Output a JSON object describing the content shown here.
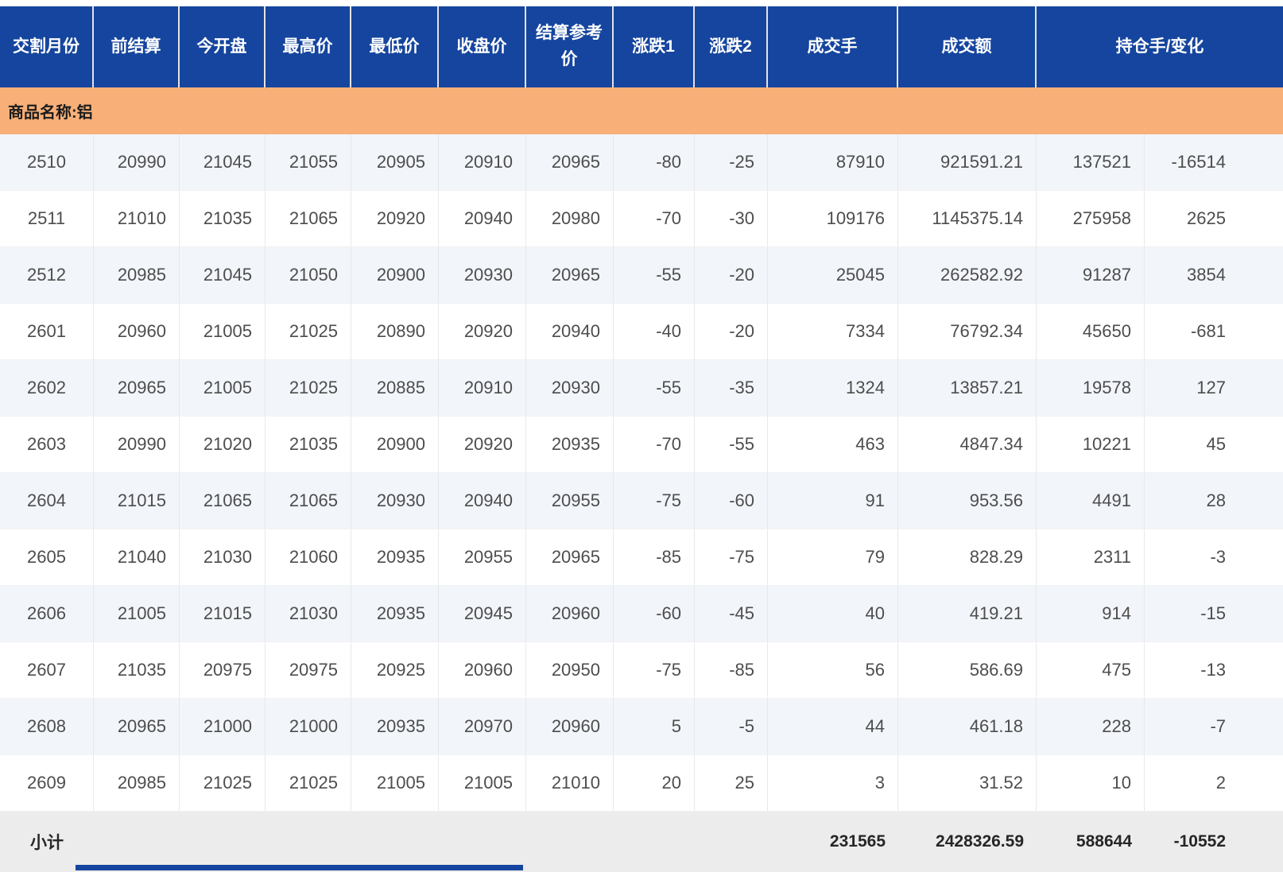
{
  "page": {
    "product_banner": "商品名称:铝"
  },
  "table": {
    "headers": [
      "交割月份",
      "前结算",
      "今开盘",
      "最高价",
      "最低价",
      "收盘价",
      "结算参考价",
      "涨跌1",
      "涨跌2",
      "成交手",
      "成交额",
      "持仓手/变化"
    ],
    "rows": [
      [
        "2510",
        "20990",
        "21045",
        "21055",
        "20905",
        "20910",
        "20965",
        "-80",
        "-25",
        "87910",
        "921591.21",
        "137521",
        "-16514"
      ],
      [
        "2511",
        "21010",
        "21035",
        "21065",
        "20920",
        "20940",
        "20980",
        "-70",
        "-30",
        "109176",
        "1145375.14",
        "275958",
        "2625"
      ],
      [
        "2512",
        "20985",
        "21045",
        "21050",
        "20900",
        "20930",
        "20965",
        "-55",
        "-20",
        "25045",
        "262582.92",
        "91287",
        "3854"
      ],
      [
        "2601",
        "20960",
        "21005",
        "21025",
        "20890",
        "20920",
        "20940",
        "-40",
        "-20",
        "7334",
        "76792.34",
        "45650",
        "-681"
      ],
      [
        "2602",
        "20965",
        "21005",
        "21025",
        "20885",
        "20910",
        "20930",
        "-55",
        "-35",
        "1324",
        "13857.21",
        "19578",
        "127"
      ],
      [
        "2603",
        "20990",
        "21020",
        "21035",
        "20900",
        "20920",
        "20935",
        "-70",
        "-55",
        "463",
        "4847.34",
        "10221",
        "45"
      ],
      [
        "2604",
        "21015",
        "21065",
        "21065",
        "20930",
        "20940",
        "20955",
        "-75",
        "-60",
        "91",
        "953.56",
        "4491",
        "28"
      ],
      [
        "2605",
        "21040",
        "21030",
        "21060",
        "20935",
        "20955",
        "20965",
        "-85",
        "-75",
        "79",
        "828.29",
        "2311",
        "-3"
      ],
      [
        "2606",
        "21005",
        "21015",
        "21030",
        "20935",
        "20945",
        "20960",
        "-60",
        "-45",
        "40",
        "419.21",
        "914",
        "-15"
      ],
      [
        "2607",
        "21035",
        "20975",
        "20975",
        "20925",
        "20960",
        "20950",
        "-75",
        "-85",
        "56",
        "586.69",
        "475",
        "-13"
      ],
      [
        "2608",
        "20965",
        "21000",
        "21000",
        "20935",
        "20970",
        "20960",
        "5",
        "-5",
        "44",
        "461.18",
        "228",
        "-7"
      ],
      [
        "2609",
        "20985",
        "21025",
        "21025",
        "21005",
        "21005",
        "21010",
        "20",
        "25",
        "3",
        "31.52",
        "10",
        "2"
      ]
    ],
    "subtotal": {
      "label": "小计",
      "volume": "231565",
      "turnover": "2428326.59",
      "open_interest": "588644",
      "oi_change": "-10552"
    }
  },
  "colors": {
    "header_bg": "#15459e",
    "banner_bg": "#f8b078",
    "alt_row_bg": "#f2f5fa",
    "subtotal_bg": "#ececec",
    "data_text": "#4d4d4d"
  }
}
